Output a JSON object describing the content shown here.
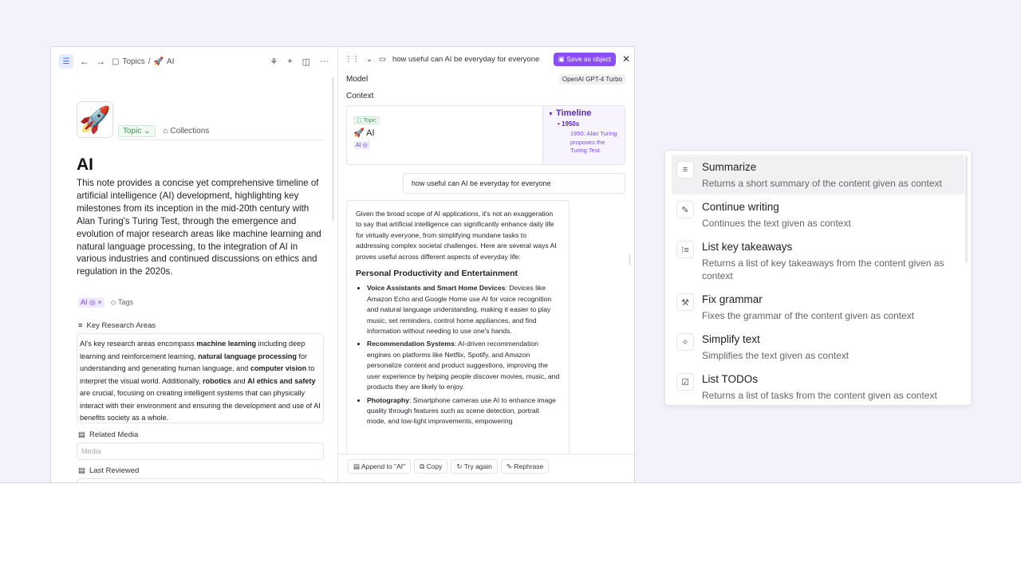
{
  "left_topbar": {
    "crumb_topics": "Topics",
    "crumb_separator": "/",
    "crumb_ai": "AI"
  },
  "note": {
    "icon": "🚀",
    "topic_label": "Topic",
    "collections_label": "Collections",
    "title": "AI",
    "description": "This note provides a concise yet comprehensive timeline of artificial intelligence (AI) development, highlighting key milestones from its inception in the mid-20th century with Alan Turing's Turing Test, through the emergence and evolution of major research areas like machine learning and natural language processing, to the integration of AI in various industries and continued discussions on ethics and regulation in the 2020s.",
    "tag_ai": "AI",
    "tags_label": "Tags",
    "key_research_label": "Key Research Areas",
    "related_media_label": "Related Media",
    "media_placeholder": "Media",
    "last_reviewed_label": "Last Reviewed"
  },
  "research": {
    "p1": "AI's key research areas encompass ",
    "b1": "machine learning",
    "p2": " including deep learning and reinforcement learning, ",
    "b2": "natural language processing",
    "p3": " for understanding and generating human language, and ",
    "b3": "computer vision",
    "p4": " to interpret the visual world. Additionally, ",
    "b4": "robotics",
    "p5": " and ",
    "b5": "AI ethics and safety",
    "p6": " are crucial, focusing on creating intelligent systems that can physically interact with their environment and ensuring the development and use of AI benefits society as a whole."
  },
  "ai_panel": {
    "query_title": "how useful can AI be everyday for everyone",
    "save_button": "Save as object",
    "model_label": "Model",
    "model_value": "OpenAI GPT-4 Turbo",
    "context_label": "Context",
    "ctx_topic": "Topic",
    "ctx_ai": "🚀 AI",
    "ctx_tag": "AI",
    "timeline_title": "Timeline",
    "timeline_decade": "1950s",
    "timeline_event": "1950: Alan Turing proposes the Turing Test.",
    "user_message": "how useful can AI be everyday for everyone"
  },
  "response": {
    "intro": "Given the broad scope of AI applications, it's not an exaggeration to say that artificial intelligence can significantly enhance daily life for virtually everyone, from simplifying mundane tasks to addressing complex societal challenges. Here are several ways AI proves useful across different aspects of everyday life:",
    "heading": "Personal Productivity and Entertainment",
    "items": [
      {
        "title": "Voice Assistants and Smart Home Devices",
        "text": ": Devices like Amazon Echo and Google Home use AI for voice recognition and natural language understanding, making it easier to play music, set reminders, control home appliances, and find information without needing to use one's hands."
      },
      {
        "title": "Recommendation Systems",
        "text": ": AI-driven recommendation engines on platforms like Netflix, Spotify, and Amazon personalize content and product suggestions, improving the user experience by helping people discover movies, music, and products they are likely to enjoy."
      },
      {
        "title": "Photography",
        "text": ": Smartphone cameras use AI to enhance image quality through features such as scene detection, portrait mode, and low-light improvements, empowering"
      }
    ]
  },
  "actions": {
    "append": "Append to \"AI\"",
    "copy": "Copy",
    "try_again": "Try again",
    "rephrase": "Rephrase"
  },
  "menu": {
    "items": [
      {
        "title": "Summarize",
        "desc": "Returns a short summary of the content given as context"
      },
      {
        "title": "Continue writing",
        "desc": "Continues the text given as context"
      },
      {
        "title": "List key takeaways",
        "desc": "Returns a list of key takeaways from the content given as context"
      },
      {
        "title": "Fix grammar",
        "desc": "Fixes the grammar of the content given as context"
      },
      {
        "title": "Simplify text",
        "desc": "Simplifies the text given as context"
      },
      {
        "title": "List TODOs",
        "desc": "Returns a list of tasks from the content given as context"
      }
    ]
  },
  "colors": {
    "accent": "#8a4dfa",
    "topic_green": "#2e9d4b",
    "tag_purple": "#6b3fd4",
    "link_blue": "#3b6ef5"
  }
}
